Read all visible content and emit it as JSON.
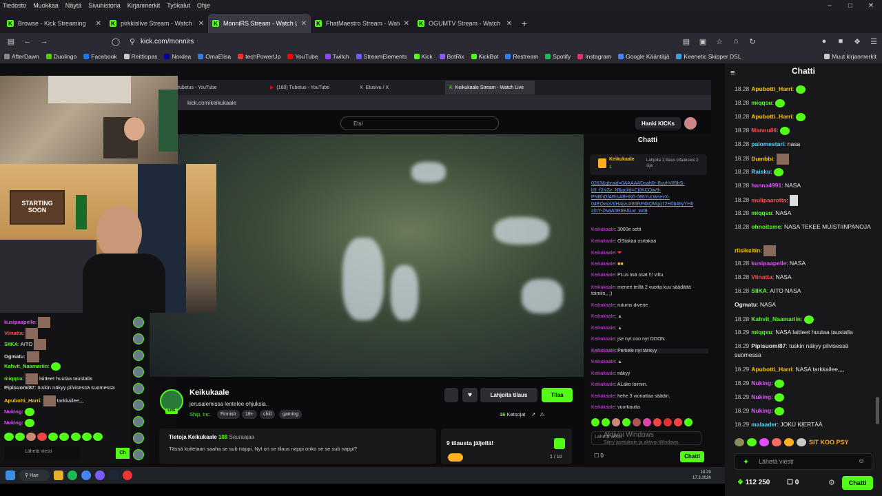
{
  "menu": [
    "Tiedosto",
    "Muokkaa",
    "Näytä",
    "Sivuhistoria",
    "Kirjanmerkit",
    "Työkalut",
    "Ohje"
  ],
  "tabs": [
    {
      "title": "Browse - Kick Streaming",
      "active": false
    },
    {
      "title": "pirkkislive Stream - Watch L",
      "active": false
    },
    {
      "title": "MonniRS Stream - Watch L",
      "active": true
    },
    {
      "title": "FhatMaestro Stream - Watc",
      "active": false
    },
    {
      "title": "OGUMTV Stream - Watch L",
      "active": false
    }
  ],
  "url": "kick.com/monnirs",
  "bookmarks": [
    {
      "label": "AfterDawn",
      "color": "#888"
    },
    {
      "label": "Duolingo",
      "color": "#58cc02"
    },
    {
      "label": "Facebook",
      "color": "#1877f2"
    },
    {
      "label": "Reittiopas",
      "color": "#ccc"
    },
    {
      "label": "Nordea",
      "color": "#0000a0"
    },
    {
      "label": "OmaElisa",
      "color": "#3a7bd5"
    },
    {
      "label": "techPowerUp",
      "color": "#e33"
    },
    {
      "label": "YouTube",
      "color": "#f00"
    },
    {
      "label": "Twitch",
      "color": "#9146ff"
    },
    {
      "label": "StreamElements",
      "color": "#6a5cff"
    },
    {
      "label": "Kick",
      "color": "#53fc18"
    },
    {
      "label": "BotRix",
      "color": "#8a5cff"
    },
    {
      "label": "KickBot",
      "color": "#53fc18"
    },
    {
      "label": "Restream",
      "color": "#2d7ff9"
    },
    {
      "label": "Spotify",
      "color": "#1db954"
    },
    {
      "label": "Instagram",
      "color": "#e1306c"
    },
    {
      "label": "Google Kääntäjä",
      "color": "#4285f4"
    },
    {
      "label": "Keenetic Skipper DSL",
      "color": "#3aa0e0"
    }
  ],
  "bookmarks_other": "Muut kirjanmerkit",
  "inner": {
    "tabs": [
      "tubetus - YouTube",
      "(160) Tubetus - YouTube",
      "Etusivu / X",
      "Keikukaale Stream - Watch Live"
    ],
    "url": "kick.com/keikukaale",
    "search_placeholder": "Etsi",
    "hanki": "Hanki KICKs",
    "streamer": "Keikukaale",
    "title": "jerusalemissa lentelee ohjuksia.",
    "category": "Ship, Inc.",
    "tags": [
      "Finnish",
      "18+",
      "chill",
      "gaming"
    ],
    "gift_label": "Lahjoita tilaus",
    "sub_label": "Tilaa",
    "viewers_num": "16",
    "viewers_label": "Katsojat",
    "live": "LIVE",
    "about_title": "Tietoja Keikukaale",
    "followers": "108",
    "followers_label": "Seuraajaa",
    "about_text": "Tässä koitetaan saaha se sub nappi, Nyt on se tilaus nappi onko se se sub nappi?",
    "subs_left": "9 tilausta jäljellä!",
    "subs_progress": "1 / 10",
    "chat_title": "Chatti",
    "pinned_name": "Keikukaale",
    "pinned_count": "1",
    "pinned_text": "Lahjoita 1 tilaus ottaaksesi 2. sija",
    "links": [
      "0263&gbraid=0AAAAADoah0r-BuvhV85bS-",
      "b3_f2ivZv_N&gclid=Cj0KCQjw9-",
      "PNBhDfARIsABHN6-086YuLWsevX-",
      "04EQwoVdHAjvuX86RP4kQMgq72H0b48yYH6",
      "2mY-2waAhR6EALw_wcB"
    ],
    "chat": [
      {
        "u": "Keikukaale",
        "t": "3000e setti"
      },
      {
        "u": "Keikukaale",
        "t": "OStakaa osrtakaa"
      },
      {
        "u": "Keikukaale",
        "t": ""
      },
      {
        "u": "Keikukaale",
        "t": ""
      },
      {
        "u": "Keikukaale",
        "t": "PLus lisä osat !!! vittu"
      },
      {
        "u": "Keikukaale",
        "t": "menee teillä 2 vuotta kuu säädättä toimiin,, ;)"
      },
      {
        "u": "Keikukaale",
        "t": "rutums divene"
      },
      {
        "u": "Keikukaale",
        "t": ""
      },
      {
        "u": "Keikukaale",
        "t": ""
      },
      {
        "u": "Keikukaale",
        "t": "jse nyt ooo nyt OOON"
      },
      {
        "u": "Keikukaale",
        "t": "Perkele nyt tänkyy"
      },
      {
        "u": "Keikukaale",
        "t": ""
      },
      {
        "u": "Keikukaale",
        "t": "näkyy"
      },
      {
        "u": "Keikukaale",
        "t": "ALako toimiin."
      },
      {
        "u": "Keikukaale",
        "t": "hehe 3 vioriattaa säädin."
      },
      {
        "u": "Keikukaale",
        "t": "vuorkautta"
      }
    ],
    "chat_input": "Lähetä viesti",
    "chat_zero": "0",
    "chat_btn": "Chatti"
  },
  "left_chat": [
    {
      "u": "kusipaapelle",
      "t": "",
      "c": "#e14dff"
    },
    {
      "u": "Viinatta",
      "t": "",
      "c": "#ff4d4d"
    },
    {
      "u": "SIIKA",
      "t": "AITO",
      "c": "#53fc18"
    },
    {
      "u": "Ogmatu",
      "t": "",
      "c": "#ddd"
    },
    {
      "u": "Kahvit_Naamariin",
      "t": "",
      "c": "#53fc18"
    },
    {
      "u": "miqqsu",
      "t": "laitteet huutaa taustalla",
      "c": "#53fc18"
    },
    {
      "u": "Pipisuomi87",
      "t": "tuskin näkyy pilvisessä suomessa",
      "c": "#ddd"
    },
    {
      "u": "Apubotti_Harri",
      "t": "tarkkailee,,,",
      "c": "#ffc400"
    },
    {
      "u": "Nuking",
      "t": "",
      "c": "#e14dff"
    },
    {
      "u": "Nuking",
      "t": "",
      "c": "#e14dff"
    }
  ],
  "left_input": "Lähetä viesti",
  "left_btn": "Ch",
  "chat": {
    "title": "Chatti",
    "lines": [
      {
        "time": "18.28",
        "user": "Apubotti_Harri",
        "color": "#ffc400",
        "text": "",
        "emote": "green"
      },
      {
        "time": "18.28",
        "user": "miqqsu",
        "color": "#53fc18",
        "text": "",
        "emote": "green"
      },
      {
        "time": "18.28",
        "user": "Apubotti_Harri",
        "color": "#ffc400",
        "text": "",
        "emote": "green"
      },
      {
        "time": "18.28",
        "user": "Mannu86",
        "color": "#ff4d4d",
        "text": "",
        "emote": "green"
      },
      {
        "time": "18.28",
        "user": "palomestari",
        "color": "#53d6ff",
        "text": "nasa",
        "emote": ""
      },
      {
        "time": "18.28",
        "user": "Dumbbi",
        "color": "#ffc400",
        "text": "",
        "emote": "photo"
      },
      {
        "time": "18.28",
        "user": "Raisku",
        "color": "#53d6ff",
        "text": "",
        "emote": "green"
      },
      {
        "time": "18.28",
        "user": "hanna4991",
        "color": "#e14dff",
        "text": "NASA",
        "emote": ""
      },
      {
        "time": "18.28",
        "user": "mulipaarotta",
        "color": "#ff4d4d",
        "text": "",
        "emote": "photo"
      },
      {
        "time": "18.28",
        "user": "miqqsu",
        "color": "#53fc18",
        "text": "NASA",
        "emote": ""
      },
      {
        "time": "18.28",
        "user": "ohnoitsme",
        "color": "#53fc18",
        "text": "NASA TEKEE MUISTIINPANOJA",
        "emote": ""
      },
      {
        "time": "",
        "user": "riisikeitin",
        "color": "#ffc400",
        "text": "",
        "emote": "photo"
      },
      {
        "time": "18.28",
        "user": "kusipaapelle",
        "color": "#e14dff",
        "text": "NASA",
        "emote": ""
      },
      {
        "time": "18.28",
        "user": "Viinatta",
        "color": "#ff4d4d",
        "text": "NASA",
        "emote": ""
      },
      {
        "time": "18.28",
        "user": "SIIKA",
        "color": "#53fc18",
        "text": "AITO NASA",
        "emote": ""
      },
      {
        "time": "",
        "user": "Ogmatu",
        "color": "#e8e8e8",
        "text": "NASA",
        "emote": ""
      },
      {
        "time": "18.28",
        "user": "Kahvit_Naamariin",
        "color": "#53fc18",
        "text": "",
        "emote": "green"
      },
      {
        "time": "18.29",
        "user": "miqqsu",
        "color": "#53fc18",
        "text": "NASA laitteet huutaa taustalla",
        "emote": ""
      },
      {
        "time": "18.29",
        "user": "Pipisuomi87",
        "color": "#e8e8e8",
        "text": "tuskin näkyy pilvisessä suomessa",
        "emote": ""
      },
      {
        "time": "18.29",
        "user": "Apubotti_Harri",
        "color": "#ffc400",
        "text": "NASA tarkkailee,,,,",
        "emote": ""
      },
      {
        "time": "18.29",
        "user": "Nuking",
        "color": "#e14dff",
        "text": "",
        "emote": "green"
      },
      {
        "time": "18.29",
        "user": "Nuking",
        "color": "#e14dff",
        "text": "",
        "emote": "green"
      },
      {
        "time": "18.29",
        "user": "Nuking",
        "color": "#e14dff",
        "text": "",
        "emote": "green"
      },
      {
        "time": "18.29",
        "user": "malaader",
        "color": "#53d6ff",
        "text": "JOKU KIERTÄÄ",
        "emote": ""
      }
    ],
    "input_placeholder": "Lähetä viesti",
    "points": "112 250",
    "zero": "0",
    "send": "Chatti",
    "emote_text": "SIT KOO PSY"
  },
  "activate": {
    "title": "Aktivoi Windows",
    "sub": "Siirry asetuksiin ja aktivoi Windows."
  },
  "taskbar": {
    "search": "Hae",
    "time": "18.29",
    "date": "17.3.2026"
  },
  "cam_text": [
    "STARTING",
    "SOON"
  ]
}
